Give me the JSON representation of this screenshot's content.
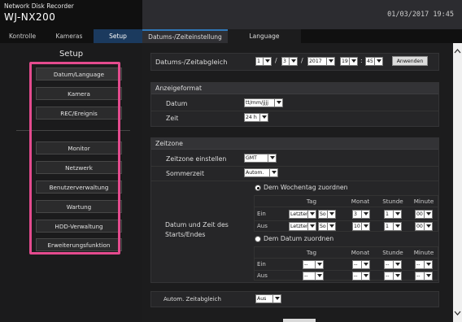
{
  "header": {
    "subtitle": "Network Disk Recorder",
    "model": "WJ-NX200",
    "datetime": "01/03/2017 19:45"
  },
  "nav": {
    "kontrolle": "Kontrolle",
    "kameras": "Kameras",
    "setup": "Setup"
  },
  "sidebar": {
    "title": "Setup",
    "items": [
      "Datum/Language",
      "Kamera",
      "REC/Ereignis",
      "Monitor",
      "Netzwerk",
      "Benutzerverwaltung",
      "Wartung",
      "HDD-Verwaltung",
      "Erweiterungsfunktion"
    ],
    "highlight_color": "#e44b8e"
  },
  "subtabs": {
    "datum": "Datums-/Zeiteinstellung",
    "language": "Language"
  },
  "zeitabgleich": {
    "label": "Datums-/Zeitabgleich",
    "month": "1",
    "sep1": "/",
    "day": "3",
    "sep2": "/",
    "year": "2017",
    "hour": "19",
    "sep3": ":",
    "minute": "45",
    "apply": "Anwenden"
  },
  "anzeigeformat": {
    "title": "Anzeigeformat",
    "datum_label": "Datum",
    "datum_value": "tt/mm/jjjj",
    "zeit_label": "Zeit",
    "zeit_value": "24 h"
  },
  "zeitzone": {
    "title": "Zeitzone",
    "tz_label": "Zeitzone einstellen",
    "tz_value": "GMT",
    "dst_label": "Sommerzeit",
    "dst_value": "Autom.",
    "startend_label_1": "Datum und Zeit des",
    "startend_label_2": "Starts/Endes",
    "mode_weekday": "Dem Wochentag zuordnen",
    "mode_date": "Dem Datum zuordnen",
    "headers": {
      "tag": "Tag",
      "monat": "Monat",
      "stunde": "Stunde",
      "minute": "Minute"
    },
    "weekday_rows": [
      {
        "label": "Ein",
        "week": "Letzter",
        "day": "So",
        "month": "3",
        "hour": "1",
        "minute": "00"
      },
      {
        "label": "Aus",
        "week": "Letzter",
        "day": "So",
        "month": "10",
        "hour": "1",
        "minute": "00"
      }
    ],
    "date_rows": [
      {
        "label": "Ein",
        "tag": "--",
        "month": "--",
        "hour": "--",
        "minute": "--"
      },
      {
        "label": "Aus",
        "tag": "--",
        "month": "--",
        "hour": "--",
        "minute": "--"
      }
    ]
  },
  "auto_sync": {
    "label": "Autom. Zeitabgleich",
    "value": "Aus"
  },
  "icons": {
    "scroll_up": "chevron-up-icon",
    "scroll_down": "chevron-down-icon",
    "dropdown": "dropdown-arrow-icon"
  }
}
